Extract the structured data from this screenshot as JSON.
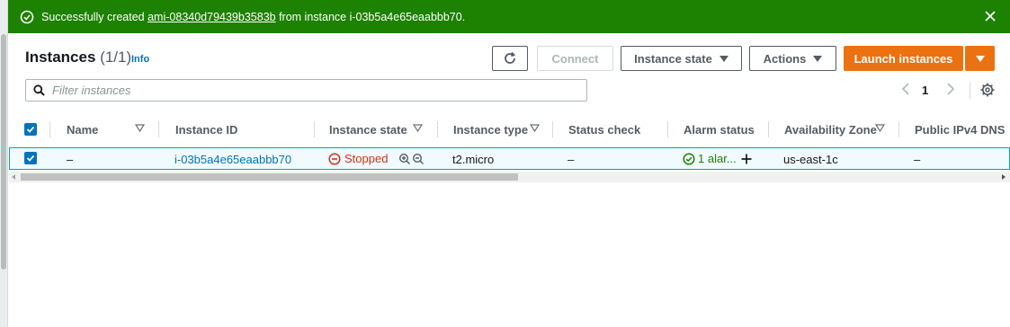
{
  "flash": {
    "prefix": "Successfully created ",
    "ami_id": "ami-08340d79439b3583b",
    "suffix": " from instance i-03b5a4e65eaabbb70.",
    "color": "#1d8102"
  },
  "header": {
    "title": "Instances",
    "count": "(1/1)",
    "info_label": "Info"
  },
  "toolbar": {
    "refresh_icon": "refresh-icon",
    "connect_label": "Connect",
    "instance_state_label": "Instance state",
    "actions_label": "Actions",
    "launch_label": "Launch instances",
    "accent_color": "#ec7211"
  },
  "filter": {
    "placeholder": "Filter instances"
  },
  "pagination": {
    "current_page": "1"
  },
  "table": {
    "columns": {
      "name": "Name",
      "instance_id": "Instance ID",
      "instance_state": "Instance state",
      "instance_type": "Instance type",
      "status_check": "Status check",
      "alarm_status": "Alarm status",
      "availability_zone": "Availability Zone",
      "public_dns": "Public IPv4 DNS"
    },
    "rows": [
      {
        "name": "–",
        "instance_id": "i-03b5a4e65eaabbb70",
        "instance_state": "Stopped",
        "instance_type": "t2.micro",
        "status_check": "–",
        "alarm_status": "1 alar...",
        "availability_zone": "us-east-1c",
        "public_dns": "–"
      }
    ]
  }
}
